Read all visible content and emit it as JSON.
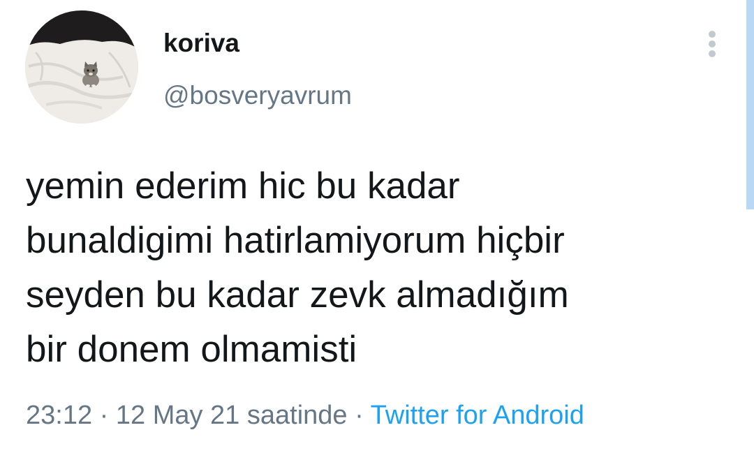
{
  "tweet": {
    "author": {
      "display_name": "koriva",
      "handle": "@bosveryavrum",
      "avatar_icon": "cat-on-bed-avatar"
    },
    "more_icon": "vertical-dots-icon",
    "text_lines": [
      "yemin ederim hic bu kadar",
      "bunaldigimi hatirlamiyorum hiçbir",
      "seyden bu kadar zevk almadığım",
      "bir donem olmamisti"
    ],
    "meta": {
      "time": "23:12",
      "separator": "·",
      "date": "12 May 21 saatinde",
      "source": "Twitter for Android"
    },
    "colors": {
      "text": "#14171a",
      "secondary": "#657786",
      "link": "#1da1f2",
      "scrollbar": "#b9d8f5"
    }
  }
}
